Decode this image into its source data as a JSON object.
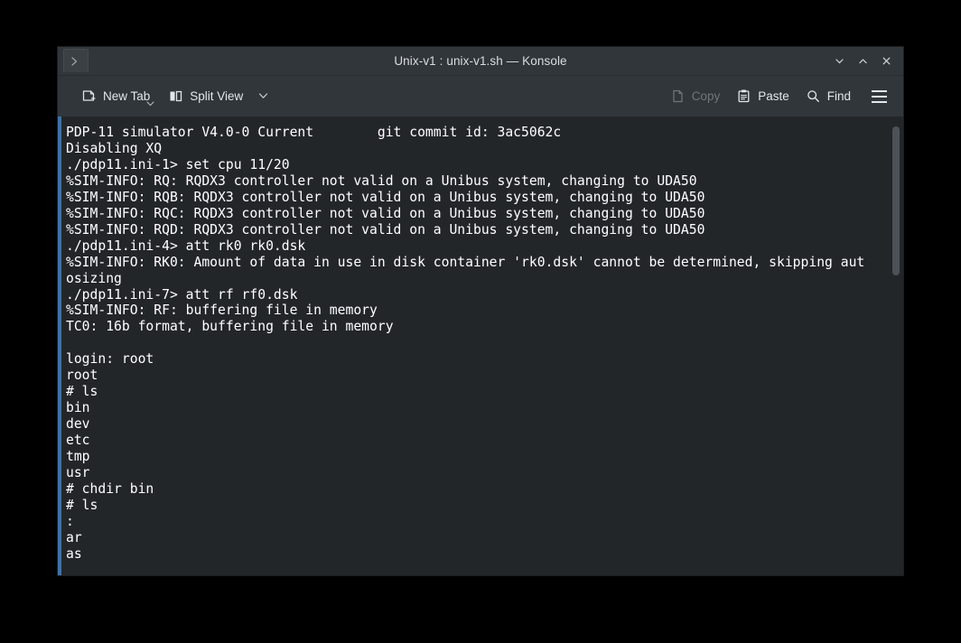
{
  "window": {
    "title": "Unix-v1 : unix-v1.sh — Konsole",
    "tab_icon": "terminal-prompt-icon",
    "controls": [
      {
        "name": "minimize",
        "glyph": "chevron-down-icon"
      },
      {
        "name": "maximize",
        "glyph": "chevron-up-icon"
      },
      {
        "name": "close",
        "glyph": "close-x-icon"
      }
    ]
  },
  "toolbar": {
    "new_tab_label": "New Tab",
    "new_tab_icon": "new-tab-icon",
    "split_view_label": "Split View",
    "split_view_icon": "split-view-icon",
    "copy_label": "Copy",
    "copy_icon": "copy-icon",
    "copy_disabled": true,
    "paste_label": "Paste",
    "paste_icon": "paste-icon",
    "find_label": "Find",
    "find_icon": "search-icon",
    "menu_icon": "hamburger-menu-icon"
  },
  "colors": {
    "window_chrome": "#31363b",
    "terminal_bg": "#232629",
    "terminal_fg": "#ffffff",
    "accent_bar": "#3a74b0",
    "scrollbar_thumb": "#4c5258",
    "disabled_text": "#6f757a"
  },
  "terminal": {
    "lines": [
      "PDP-11 simulator V4.0-0 Current        git commit id: 3ac5062c",
      "Disabling XQ",
      "./pdp11.ini-1> set cpu 11/20",
      "%SIM-INFO: RQ: RQDX3 controller not valid on a Unibus system, changing to UDA50",
      "%SIM-INFO: RQB: RQDX3 controller not valid on a Unibus system, changing to UDA50",
      "%SIM-INFO: RQC: RQDX3 controller not valid on a Unibus system, changing to UDA50",
      "%SIM-INFO: RQD: RQDX3 controller not valid on a Unibus system, changing to UDA50",
      "./pdp11.ini-4> att rk0 rk0.dsk",
      "%SIM-INFO: RK0: Amount of data in use in disk container 'rk0.dsk' cannot be determined, skipping aut",
      "osizing",
      "./pdp11.ini-7> att rf rf0.dsk",
      "%SIM-INFO: RF: buffering file in memory",
      "TC0: 16b format, buffering file in memory",
      "",
      "login: root",
      "root",
      "# ls",
      "bin",
      "dev",
      "etc",
      "tmp",
      "usr",
      "# chdir bin",
      "# ls",
      ":",
      "ar",
      "as"
    ]
  },
  "scrollbar": {
    "name": "terminal-vertical-scrollbar"
  }
}
